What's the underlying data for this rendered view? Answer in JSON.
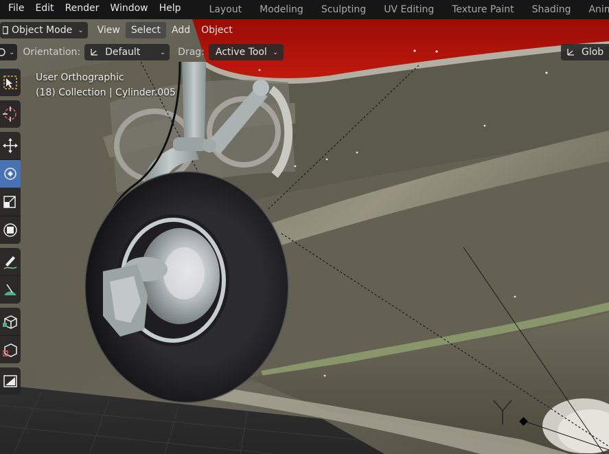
{
  "menubar": {
    "items": [
      "File",
      "Edit",
      "Render",
      "Window",
      "Help"
    ]
  },
  "workspaces": {
    "tabs": [
      "Layout",
      "Modeling",
      "Sculpting",
      "UV Editing",
      "Texture Paint",
      "Shading",
      "Animati"
    ]
  },
  "header": {
    "mode_label": "Object Mode",
    "view_label": "View",
    "select_label": "Select",
    "add_label": "Add",
    "object_label": "Object"
  },
  "tool_settings": {
    "orientation_label": "Orientation:",
    "orientation_value": "Default",
    "drag_label": "Drag:",
    "drag_value": "Active Tool",
    "transform_value": "Glob"
  },
  "viewport": {
    "view_name": "User Orthographic",
    "collection_info": "(18) Collection | Cylinder.005",
    "axis_label": "Y"
  },
  "toolbar": {
    "tools": [
      {
        "name": "select-box-icon",
        "active": false
      },
      {
        "name": "cursor-icon",
        "active": false
      },
      {
        "name": "move-icon",
        "active": false
      },
      {
        "name": "rotate-icon",
        "active": true
      },
      {
        "name": "scale-icon",
        "active": false
      },
      {
        "name": "transform-icon",
        "active": false
      },
      {
        "name": "annotate-icon",
        "active": false
      },
      {
        "name": "measure-icon",
        "active": false
      },
      {
        "name": "add-cube-icon",
        "active": false
      },
      {
        "name": "cube-edit-icon",
        "active": false
      },
      {
        "name": "image-icon",
        "active": false
      }
    ]
  },
  "colors": {
    "accent": "#4772b3",
    "fuselage_red": "#b5130a",
    "background": "#1d1d1d"
  }
}
